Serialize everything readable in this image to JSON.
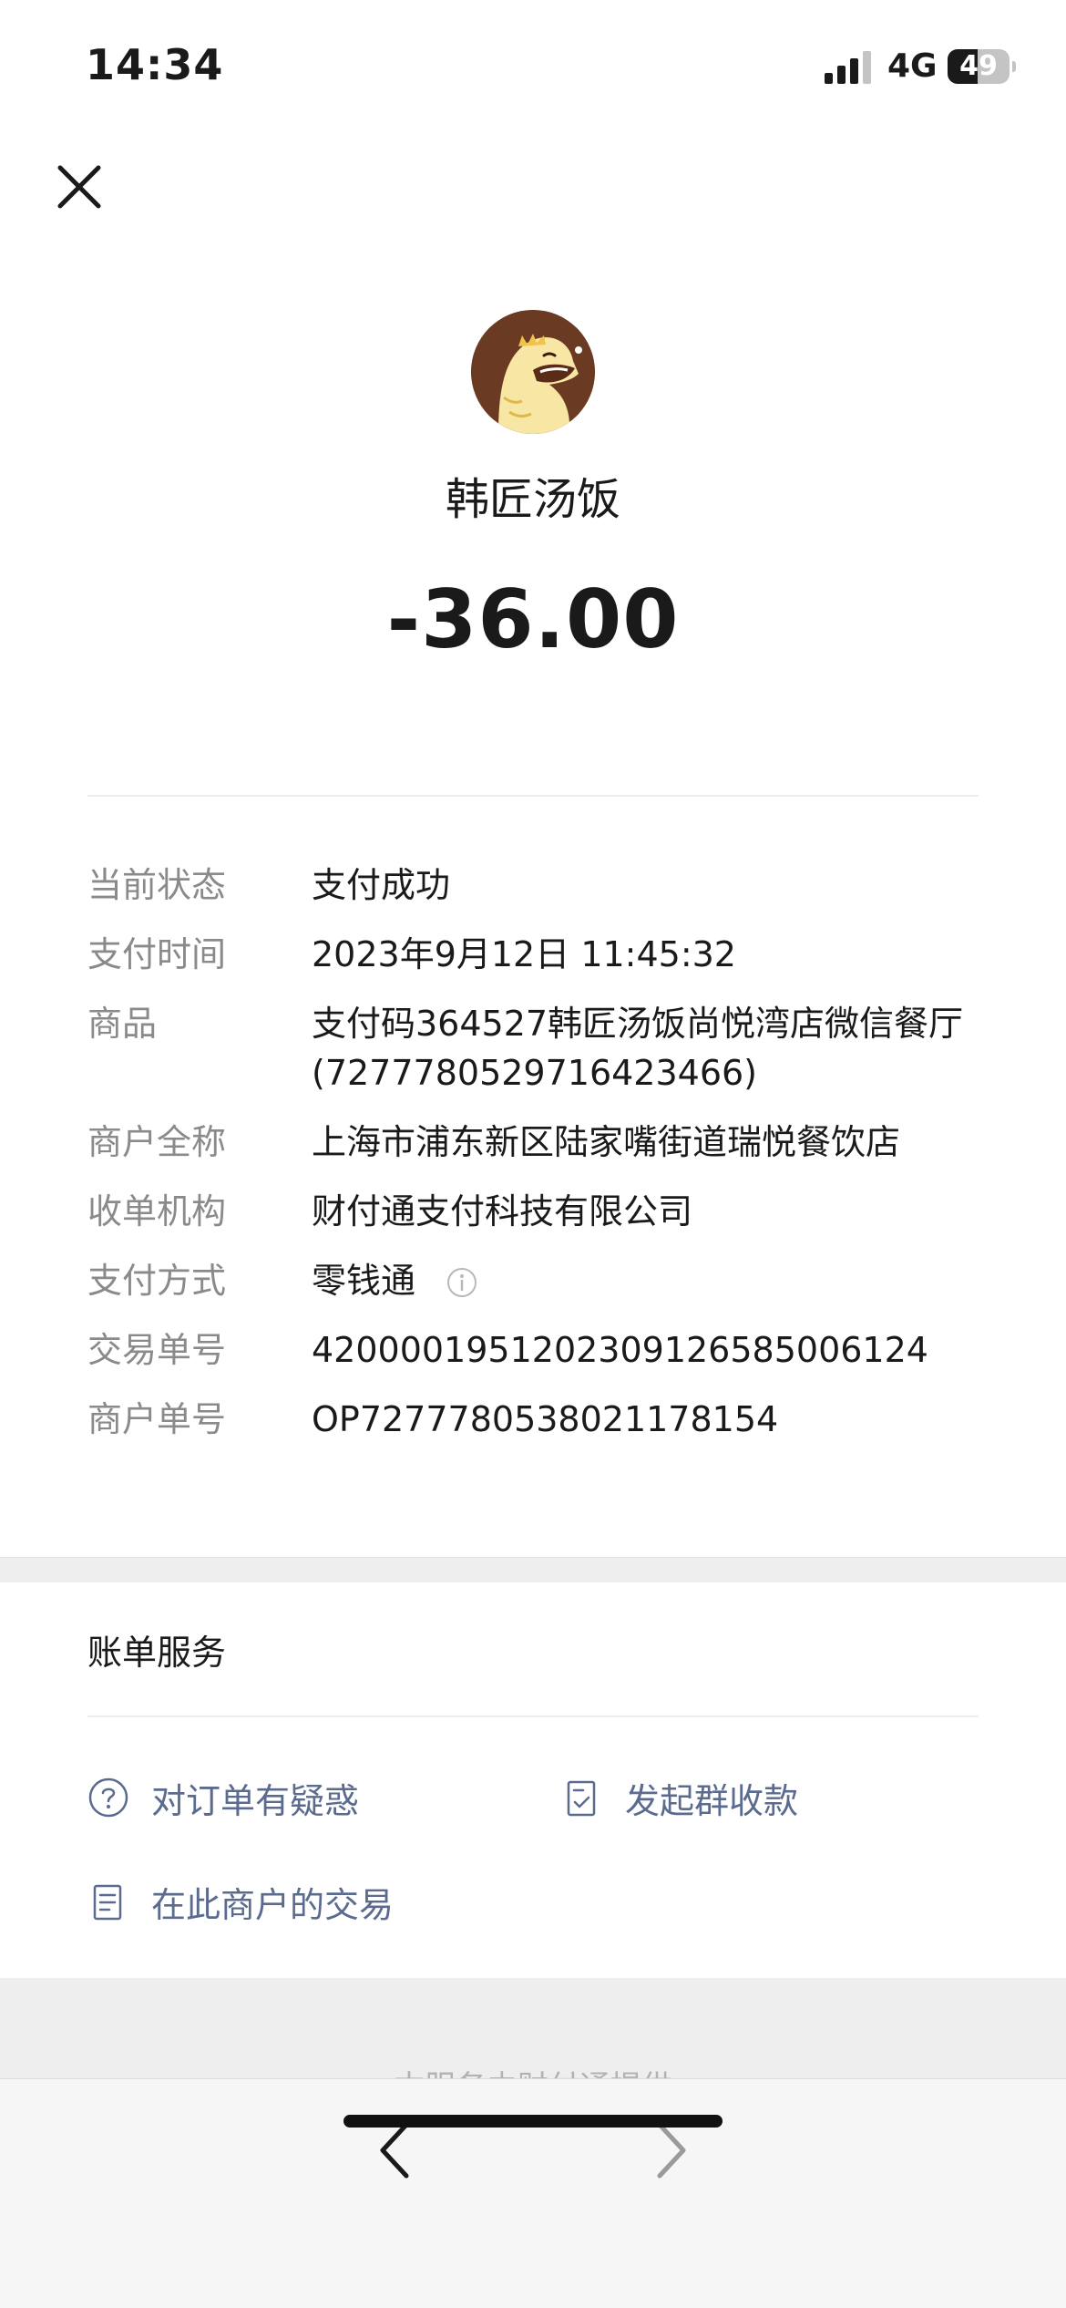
{
  "status_bar": {
    "time": "14:34",
    "network": "4G",
    "battery_level": "49",
    "battery_fraction": 0.49
  },
  "colors": {
    "label_gray": "#8a8a8a",
    "link_blue": "#5b6b8f",
    "separator": "#eeeeee"
  },
  "icons": {
    "close": "close-icon",
    "signal": "signal-icon",
    "battery": "battery-icon",
    "avatar": "dinosaur-avatar",
    "info": "info-icon",
    "question": "question-circle-icon",
    "group_collect": "receipt-check-icon",
    "merchant_tx": "document-icon",
    "back": "chevron-left-icon",
    "forward": "chevron-right-icon"
  },
  "merchant": {
    "name": "韩匠汤饭",
    "amount": "-36.00"
  },
  "details": [
    {
      "label": "当前状态",
      "value": "支付成功"
    },
    {
      "label": "支付时间",
      "value": "2023年9月12日 11:45:32"
    },
    {
      "label": "商品",
      "value": "支付码364527韩匠汤饭尚悦湾店微信餐厅(7277780529716423466)"
    },
    {
      "label": "商户全称",
      "value": "上海市浦东新区陆家嘴街道瑞悦餐饮店"
    },
    {
      "label": "收单机构",
      "value": "财付通支付科技有限公司"
    },
    {
      "label": "支付方式",
      "value": "零钱通"
    },
    {
      "label": "交易单号",
      "value": "4200001951202309126585006124"
    },
    {
      "label": "商户单号",
      "value": "OP7277780538021178154"
    }
  ],
  "services": {
    "title": "账单服务",
    "items": [
      {
        "label": "对订单有疑惑"
      },
      {
        "label": "发起群收款"
      },
      {
        "label": "在此商户的交易"
      }
    ]
  },
  "footer": {
    "note": "本服务由财付通提供"
  }
}
